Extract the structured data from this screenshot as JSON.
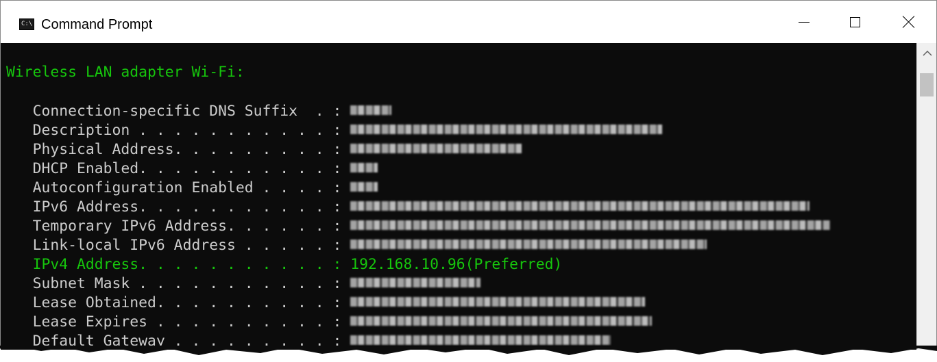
{
  "window": {
    "title": "Command Prompt",
    "icon_text": "C:\\",
    "controls": [
      "minimize-icon",
      "maximize-icon",
      "close-icon"
    ]
  },
  "console": {
    "header": "Wireless LAN adapter Wi-Fi:",
    "rows": [
      {
        "label": "   Connection-specific DNS Suffix  . : ",
        "blurred": true,
        "value_width": 60
      },
      {
        "label": "   Description . . . . . . . . . . . : ",
        "blurred": true,
        "value_width": 455
      },
      {
        "label": "   Physical Address. . . . . . . . . : ",
        "blurred": true,
        "value_width": 250
      },
      {
        "label": "   DHCP Enabled. . . . . . . . . . . : ",
        "blurred": true,
        "value_width": 40
      },
      {
        "label": "   Autoconfiguration Enabled . . . . : ",
        "blurred": true,
        "value_width": 40
      },
      {
        "label": "   IPv6 Address. . . . . . . . . . . : ",
        "blurred": true,
        "value_width": 670
      },
      {
        "label": "   Temporary IPv6 Address. . . . . . : ",
        "blurred": true,
        "value_width": 700
      },
      {
        "label": "   Link-local IPv6 Address . . . . . : ",
        "blurred": true,
        "value_width": 520
      },
      {
        "label": "   IPv4 Address. . . . . . . . . . . : ",
        "value": "192.168.10.96(Preferred)",
        "highlight": true
      },
      {
        "label": "   Subnet Mask . . . . . . . . . . . : ",
        "blurred": true,
        "value_width": 190
      },
      {
        "label": "   Lease Obtained. . . . . . . . . . : ",
        "blurred": true,
        "value_width": 430
      },
      {
        "label": "   Lease Expires . . . . . . . . . . : ",
        "blurred": true,
        "value_width": 440
      },
      {
        "label": "   Default Gateway . . . . . . . . . : ",
        "blurred": true,
        "value_width": 380
      }
    ]
  },
  "scrollbar": {
    "up_arrow": "^"
  },
  "colors": {
    "console_bg": "#0c0c0c",
    "console_text": "#cccccc",
    "highlight": "#16c60c",
    "titlebar_bg": "#ffffff",
    "scrollbar_bg": "#f0f0f0"
  }
}
